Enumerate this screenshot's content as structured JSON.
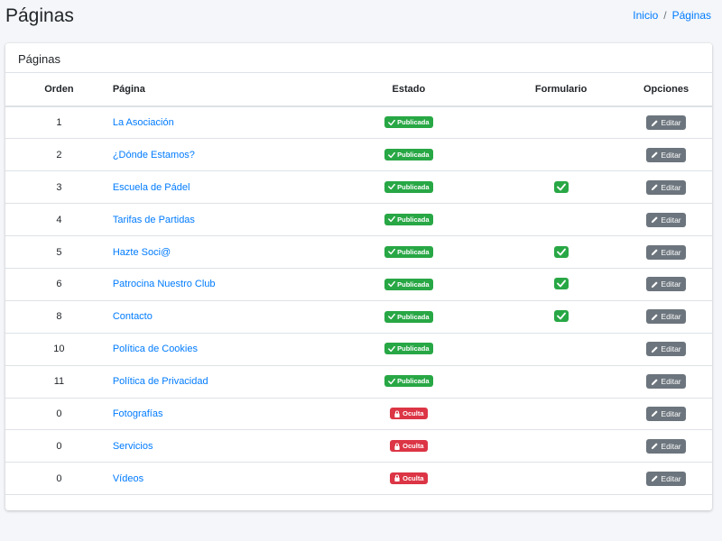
{
  "header": {
    "title": "Páginas",
    "breadcrumb": {
      "home": "Inicio",
      "separator": "/",
      "current": "Páginas"
    }
  },
  "card": {
    "title": "Páginas",
    "columns": {
      "orden": "Orden",
      "pagina": "Página",
      "estado": "Estado",
      "formulario": "Formulario",
      "opciones": "Opciones"
    },
    "edit_label": "Editar",
    "rows": [
      {
        "orden": "1",
        "pagina": "La Asociación",
        "estado": "Publicada",
        "status": "published",
        "formulario": false
      },
      {
        "orden": "2",
        "pagina": "¿Dónde Estamos?",
        "estado": "Publicada",
        "status": "published",
        "formulario": false
      },
      {
        "orden": "3",
        "pagina": "Escuela de Pádel",
        "estado": "Publicada",
        "status": "published",
        "formulario": true
      },
      {
        "orden": "4",
        "pagina": "Tarifas de Partidas",
        "estado": "Publicada",
        "status": "published",
        "formulario": false
      },
      {
        "orden": "5",
        "pagina": "Hazte Soci@",
        "estado": "Publicada",
        "status": "published",
        "formulario": true
      },
      {
        "orden": "6",
        "pagina": "Patrocina Nuestro Club",
        "estado": "Publicada",
        "status": "published",
        "formulario": true
      },
      {
        "orden": "8",
        "pagina": "Contacto",
        "estado": "Publicada",
        "status": "published",
        "formulario": true
      },
      {
        "orden": "10",
        "pagina": "Política de Cookies",
        "estado": "Publicada",
        "status": "published",
        "formulario": false
      },
      {
        "orden": "11",
        "pagina": "Política de Privacidad",
        "estado": "Publicada",
        "status": "published",
        "formulario": false
      },
      {
        "orden": "0",
        "pagina": "Fotografías",
        "estado": "Oculta",
        "status": "hidden",
        "formulario": false
      },
      {
        "orden": "0",
        "pagina": "Servicios",
        "estado": "Oculta",
        "status": "hidden",
        "formulario": false
      },
      {
        "orden": "0",
        "pagina": "Vídeos",
        "estado": "Oculta",
        "status": "hidden",
        "formulario": false
      }
    ]
  },
  "colors": {
    "success": "#28a745",
    "danger": "#dc3545",
    "secondary": "#6c757d",
    "link": "#007bff"
  },
  "icons": {
    "published": "check-icon",
    "hidden": "lock-icon",
    "formulario": "check-icon",
    "edit": "pencil-icon"
  }
}
